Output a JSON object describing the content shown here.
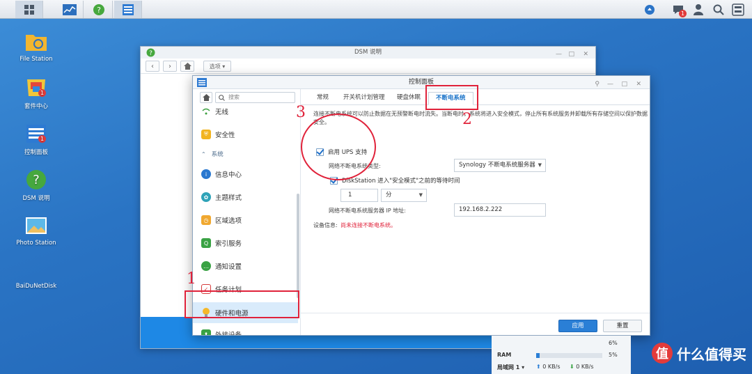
{
  "taskbar": {
    "buttons": [
      "main-menu",
      "resource-monitor",
      "dsm-help",
      "control-panel"
    ],
    "right_badge": "1"
  },
  "desktop": {
    "icons": [
      {
        "label": "File Station"
      },
      {
        "label": "套件中心",
        "badge": "1"
      },
      {
        "label": "控制面板",
        "badge": "1"
      },
      {
        "label": "DSM 说明"
      },
      {
        "label": "Photo Station"
      },
      {
        "label": "BaiDuNetDisk"
      }
    ]
  },
  "help_window": {
    "title": "DSM 说明",
    "options_label": "选项"
  },
  "control_panel": {
    "title": "控制面板",
    "search_placeholder": "搜索",
    "sidebar": {
      "items": [
        {
          "label": "无线",
          "icon": "wifi-icon"
        },
        {
          "label": "安全性",
          "icon": "shield-icon"
        },
        {
          "label": "系统",
          "section": true
        },
        {
          "label": "信息中心",
          "icon": "info-icon"
        },
        {
          "label": "主题样式",
          "icon": "palette-icon"
        },
        {
          "label": "区域选项",
          "icon": "clock-icon"
        },
        {
          "label": "索引服务",
          "icon": "search-index-icon"
        },
        {
          "label": "通知设置",
          "icon": "chat-icon"
        },
        {
          "label": "任务计划",
          "icon": "calendar-icon"
        },
        {
          "label": "硬件和电源",
          "icon": "bulb-icon",
          "selected": true
        },
        {
          "label": "外接设备",
          "icon": "upload-icon"
        }
      ]
    },
    "tabs": [
      "常规",
      "开关机计划管理",
      "硬盘休眠",
      "不断电系统"
    ],
    "active_tab": "不断电系统",
    "ups": {
      "description": "连接不断电系统可以防止数据在无预警断电时流失。当断电时，系统将进入安全模式，停止所有系统服务并卸载所有存储空间以保护数据安全。",
      "enable_label": "启用 UPS 支持",
      "type_label": "网络不断电系统类型:",
      "type_value": "Synology 不断电系统服务器",
      "safe_mode_label": "DiskStation 进入\"安全模式\"之前的等待时间",
      "wait_value": "1",
      "wait_unit": "分",
      "server_ip_label": "网络不断电系统服务器 IP 地址:",
      "server_ip_value": "192.168.2.222",
      "device_info_label": "设备信息:",
      "device_info_value": "尚未连接不断电系统。"
    },
    "apply_label": "应用",
    "reset_label": "重置"
  },
  "annotations": {
    "n1": "1",
    "n2": "2",
    "n3": "3"
  },
  "resource_widget": {
    "cpu_pct": "6%",
    "ram_label": "RAM",
    "ram_pct": "5%",
    "lan_label": "局域网 1",
    "up_rate": "0 KB/s",
    "down_rate": "0 KB/s"
  },
  "watermark": {
    "logo_text": "值",
    "text": "什么值得买"
  },
  "colors": {
    "accent": "#2a7fd6",
    "annotation_red": "#e0223a",
    "desktop_blue": "#2a74c4"
  }
}
